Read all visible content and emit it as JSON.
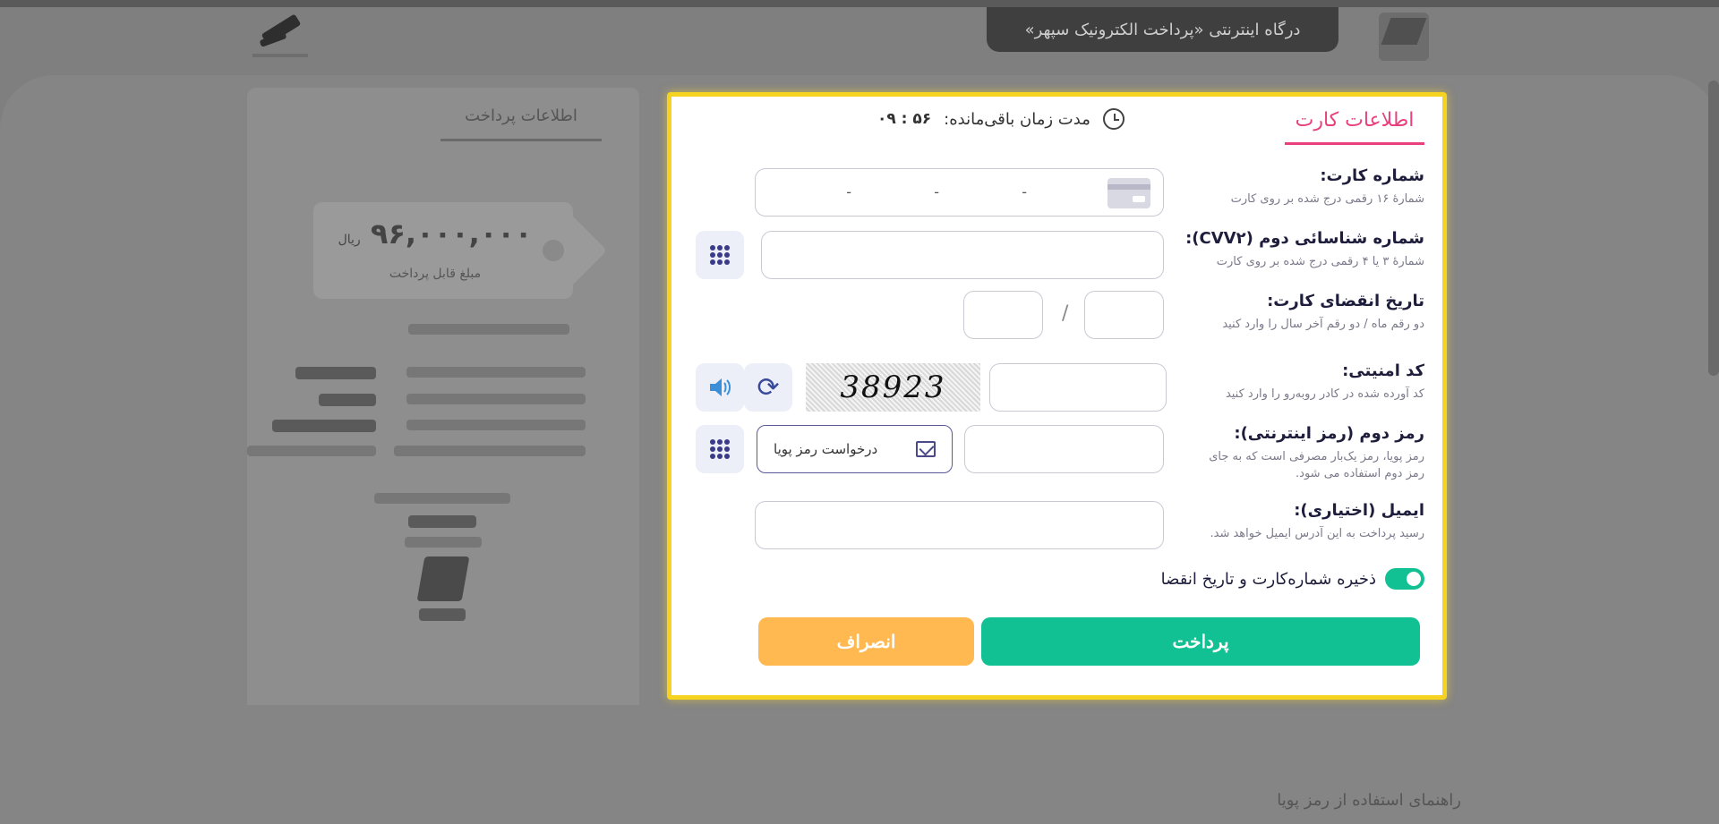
{
  "background": {
    "gateway_title": "درگاه اینترنتی «پرداخت الکترونیک سپهر»",
    "payment_info_tab": "اطلاعات پرداخت",
    "amount_value": "۹۶,۰۰۰,۰۰۰",
    "amount_unit": "ریال",
    "amount_label": "مبلغ قابل پرداخت",
    "help_link": "راهنمای استفاده از رمز پویا"
  },
  "modal": {
    "tab_label": "اطلاعات کارت",
    "timer_label": "مدت زمان باقی‌مانده:",
    "timer_value": "۰۹ : ۵۶",
    "card_number": {
      "label": "شماره کارت:",
      "hint": "شمارهٔ ۱۶ رقمی درج شده بر روی کارت",
      "separator": "-"
    },
    "cvv2": {
      "label": "شماره شناسائی دوم (CVV۲):",
      "hint": "شمارهٔ ۳ یا ۴ رقمی درج شده بر روی کارت"
    },
    "expiry": {
      "label": "تاریخ انقضای کارت:",
      "hint": "دو رقم ماه / دو رقم آخر سال را وارد کنید",
      "separator": "/"
    },
    "captcha": {
      "label": "کد امنیتی:",
      "hint": "کد آورده شده در کادر روبه‌رو را وارد کنید",
      "image_text": "38923"
    },
    "pin2": {
      "label": "رمز دوم (رمز اینترنتی):",
      "hint_line1": "رمز پویا، رمز یک‌بار مصرفی است که به جای",
      "hint_line2": "رمز دوم استفاده می شود.",
      "request_button": "درخواست رمز پویا"
    },
    "email": {
      "label": "ایمیل (اختیاری):",
      "hint": "رسید پرداخت به این آدرس ایمیل خواهد شد."
    },
    "save_toggle_label": "ذخیره شماره‌کارت و تاریخ انقضا",
    "pay_button": "پرداخت",
    "cancel_button": "انصراف"
  },
  "colors": {
    "accent_pink": "#e8407d",
    "pay_green": "#12c193",
    "cancel_orange": "#ffb950",
    "modal_border": "#f6d321"
  },
  "icons": [
    "clock-icon",
    "credit-card-icon",
    "keypad-icon",
    "refresh-icon",
    "speaker-icon",
    "mail-icon"
  ]
}
